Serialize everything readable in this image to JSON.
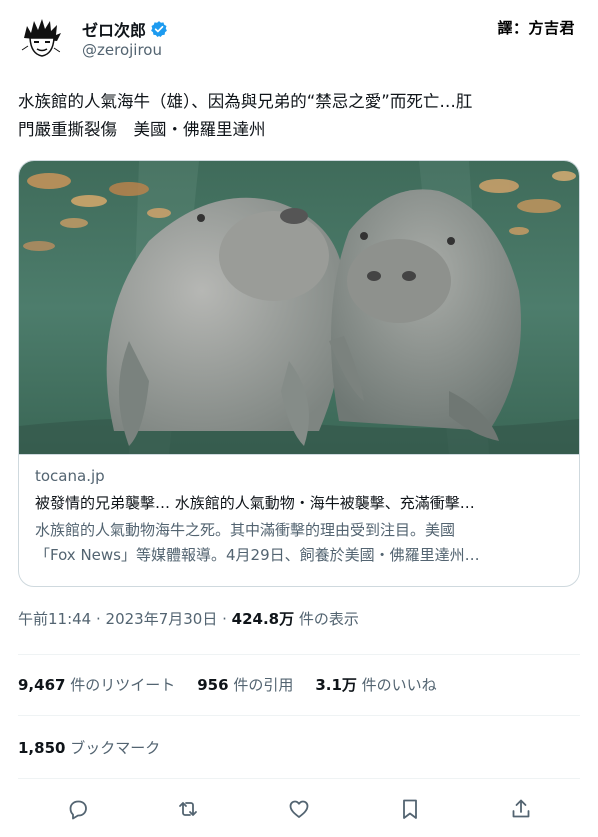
{
  "author": {
    "display_name": "ゼロ次郎",
    "handle": "@zerojirou",
    "verified": true,
    "avatar_icon": "manga-character-avatar-icon"
  },
  "translator_credit": "譯：方吉君",
  "tweet": {
    "text_line1": "水族館的人氣海牛（雄）、因為與兄弟的“禁忌之愛”而死亡…肛",
    "text_line2": "門嚴重撕裂傷　美國・佛羅里達州"
  },
  "card": {
    "image_icon": "two-manatees-underwater-photo",
    "domain": "tocana.jp",
    "title": "被發情的兄弟襲擊… 水族館的人氣動物・海牛被襲擊、充滿衝擊…",
    "desc_line1": "水族館的人氣動物海牛之死。其中滿衝擊的理由受到注目。美國",
    "desc_line2": "「Fox News」等媒體報導。4月29日、飼養於美國・佛羅里達州…"
  },
  "meta": {
    "time": "午前11:44",
    "sep1": " · ",
    "date": "2023年7月30日",
    "sep2": " · ",
    "views": "424.8万",
    "views_label": " 件の表示"
  },
  "stats": {
    "retweets": "9,467",
    "retweets_label": " 件のリツイート",
    "quotes": "956",
    "quotes_label": " 件の引用",
    "likes": "3.1万",
    "likes_label": " 件のいいね",
    "bookmarks": "1,850",
    "bookmarks_label": " ブックマーク"
  },
  "actions": [
    "reply-icon",
    "retweet-icon",
    "like-icon",
    "bookmark-icon",
    "share-icon"
  ],
  "colors": {
    "text": "#0f1419",
    "secondary": "#536471",
    "border": "#cfd9de",
    "verified": "#1d9bf0"
  }
}
